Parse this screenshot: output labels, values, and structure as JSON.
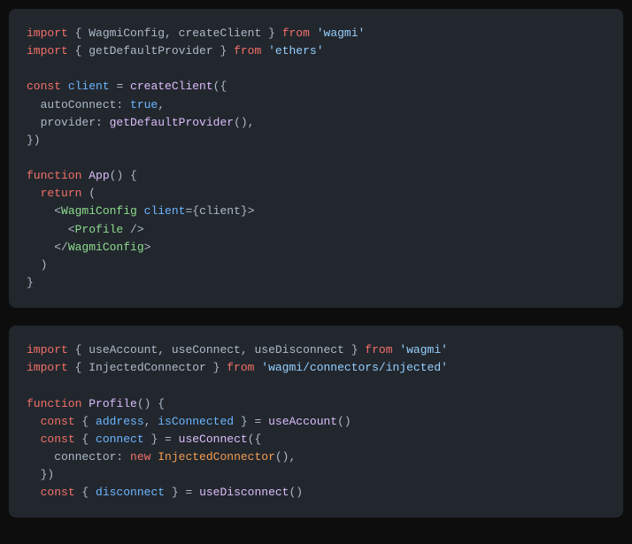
{
  "block1": {
    "t01": "import",
    "t02": " { ",
    "t03": "WagmiConfig",
    "t04": ", ",
    "t05": "createClient",
    "t06": " } ",
    "t07": "from",
    "t08": " ",
    "t09": "'wagmi'",
    "t10": "import",
    "t11": " { ",
    "t12": "getDefaultProvider",
    "t13": " } ",
    "t14": "from",
    "t15": " ",
    "t16": "'ethers'",
    "t20": "const",
    "t21": " ",
    "t22": "client",
    "t23": " = ",
    "t24": "createClient",
    "t25": "({",
    "t26": "  autoConnect",
    "t27": ": ",
    "t28": "true",
    "t29": ",",
    "t30": "  provider",
    "t31": ": ",
    "t32": "getDefaultProvider",
    "t33": "(),",
    "t34": "})",
    "t40": "function",
    "t41": " ",
    "t42": "App",
    "t43": "() {",
    "t44": "  ",
    "t45": "return",
    "t46": " (",
    "t47": "    <",
    "t48": "WagmiConfig",
    "t49": " ",
    "t50": "client",
    "t51": "={",
    "t52": "client",
    "t53": "}>",
    "t54": "      <",
    "t55": "Profile",
    "t56": " />",
    "t57": "    </",
    "t58": "WagmiConfig",
    "t59": ">",
    "t60": "  )",
    "t61": "}"
  },
  "block2": {
    "t01": "import",
    "t02": " { ",
    "t03": "useAccount",
    "t04": ", ",
    "t05": "useConnect",
    "t06": ", ",
    "t07": "useDisconnect",
    "t08": " } ",
    "t09": "from",
    "t10": " ",
    "t11": "'wagmi'",
    "t12": "import",
    "t13": " { ",
    "t14": "InjectedConnector",
    "t15": " } ",
    "t16": "from",
    "t17": " ",
    "t18": "'wagmi/connectors/injected'",
    "t20": "function",
    "t21": " ",
    "t22": "Profile",
    "t23": "() {",
    "t24": "  ",
    "t25": "const",
    "t26": " { ",
    "t27": "address",
    "t28": ", ",
    "t29": "isConnected",
    "t30": " } = ",
    "t31": "useAccount",
    "t32": "()",
    "t33": "  ",
    "t34": "const",
    "t35": " { ",
    "t36": "connect",
    "t37": " } = ",
    "t38": "useConnect",
    "t39": "({",
    "t40": "    connector",
    "t41": ": ",
    "t42": "new",
    "t43": " ",
    "t44": "InjectedConnector",
    "t45": "(),",
    "t46": "  })",
    "t47": "  ",
    "t48": "const",
    "t49": " { ",
    "t50": "disconnect",
    "t51": " } = ",
    "t52": "useDisconnect",
    "t53": "()"
  }
}
